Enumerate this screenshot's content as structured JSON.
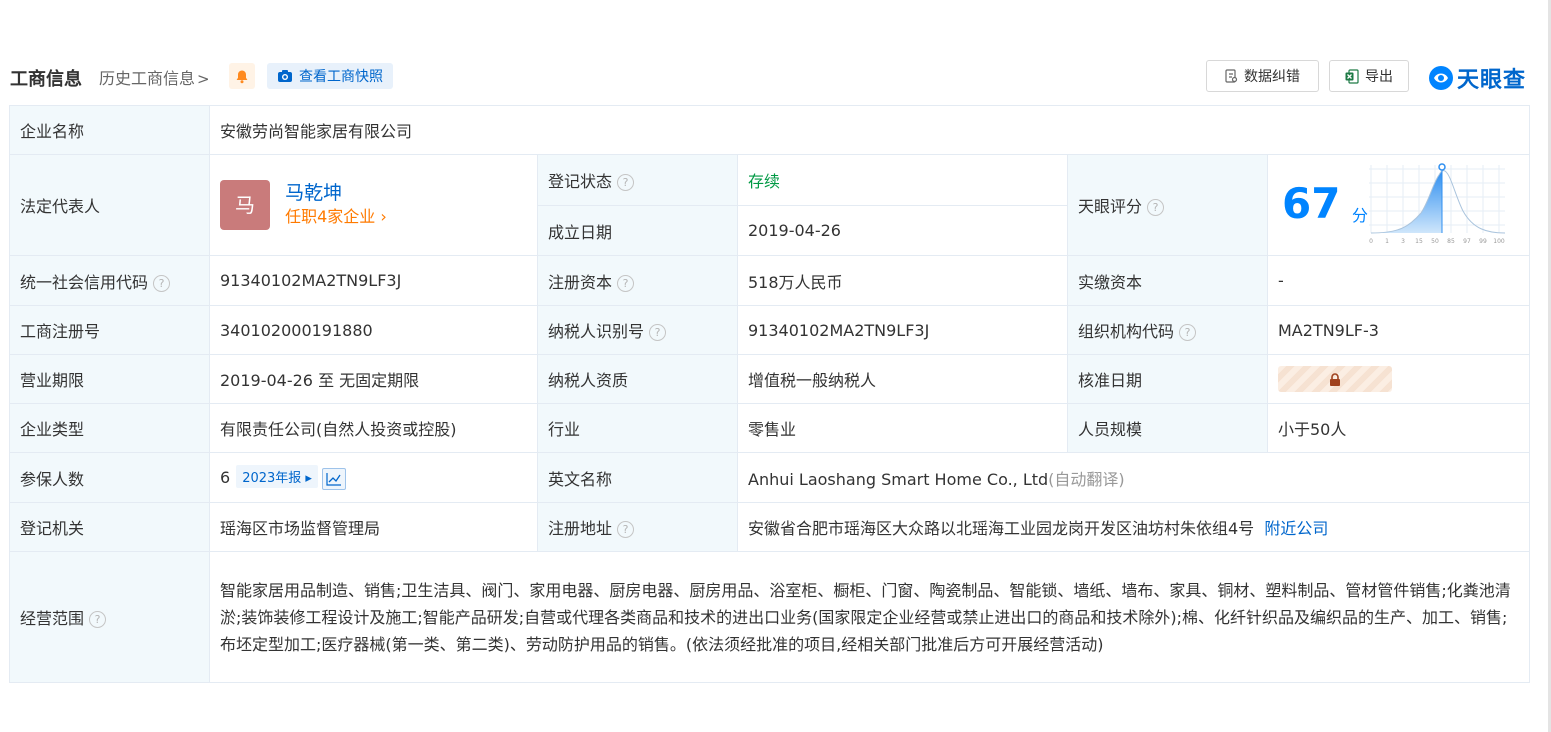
{
  "header": {
    "title": "工商信息",
    "history_link": "历史工商信息",
    "history_chevron": ">",
    "snapshot_button": "查看工商快照",
    "correction_button": "数据纠错",
    "export_button": "导出",
    "logo_text": "天眼查",
    "bell_color": "#ff8a1f"
  },
  "labels": {
    "company_name": "企业名称",
    "legal_rep": "法定代表人",
    "reg_status": "登记状态",
    "founded": "成立日期",
    "tianyan_score": "天眼评分",
    "credit_code": "统一社会信用代码",
    "reg_capital": "注册资本",
    "paid_capital": "实缴资本",
    "reg_number": "工商注册号",
    "taxpayer_id": "纳税人识别号",
    "org_code": "组织机构代码",
    "business_term": "营业期限",
    "taxpayer_qual": "纳税人资质",
    "approval_date": "核准日期",
    "company_type": "企业类型",
    "industry": "行业",
    "staff_size": "人员规模",
    "insured": "参保人数",
    "english_name": "英文名称",
    "reg_authority": "登记机关",
    "reg_address": "注册地址",
    "scope": "经营范围"
  },
  "values": {
    "company_name": "安徽劳尚智能家居有限公司",
    "legal_rep_avatar": "马",
    "legal_rep_name": "马乾坤",
    "legal_rep_jobs": "任职4家企业",
    "reg_status": "存续",
    "founded": "2019-04-26",
    "score": "67",
    "score_unit": "分",
    "score_axis": [
      "0",
      "1",
      "3",
      "15",
      "50",
      "85",
      "97",
      "99",
      "100"
    ],
    "credit_code": "91340102MA2TN9LF3J",
    "reg_capital": "518万人民币",
    "paid_capital": "-",
    "reg_number": "340102000191880",
    "taxpayer_id": "91340102MA2TN9LF3J",
    "org_code": "MA2TN9LF-3",
    "business_term": "2019-04-26 至 无固定期限",
    "taxpayer_qual": "增值税一般纳税人",
    "company_type": "有限责任公司(自然人投资或控股)",
    "industry": "零售业",
    "staff_size": "小于50人",
    "insured": "6",
    "insured_year": "2023年报",
    "english_name": "Anhui Laoshang Smart Home Co., Ltd",
    "english_note": "(自动翻译)",
    "reg_authority": "瑶海区市场监督管理局",
    "reg_address": "安徽省合肥市瑶海区大众路以北瑶海工业园龙岗开发区油坊村朱依组4号",
    "nearby": "附近公司",
    "scope": "智能家居用品制造、销售;卫生洁具、阀门、家用电器、厨房电器、厨房用品、浴室柜、橱柜、门窗、陶瓷制品、智能锁、墙纸、墙布、家具、铜材、塑料制品、管材管件销售;化粪池清淤;装饰装修工程设计及施工;智能产品研发;自营或代理各类商品和技术的进出口业务(国家限定企业经营或禁止进出口的商品和技术除外);棉、化纤针织品及编织品的生产、加工、销售;布坯定型加工;医疗器械(第一类、第二类)、劳动防护用品的销售。(依法须经批准的项目,经相关部门批准后方可开展经营活动)"
  },
  "colors": {
    "link": "#0066cc",
    "status_green": "#009944",
    "jobs_orange": "#ff7a00",
    "score_blue": "#0084ff",
    "label_bg": "#f2f9fc"
  }
}
